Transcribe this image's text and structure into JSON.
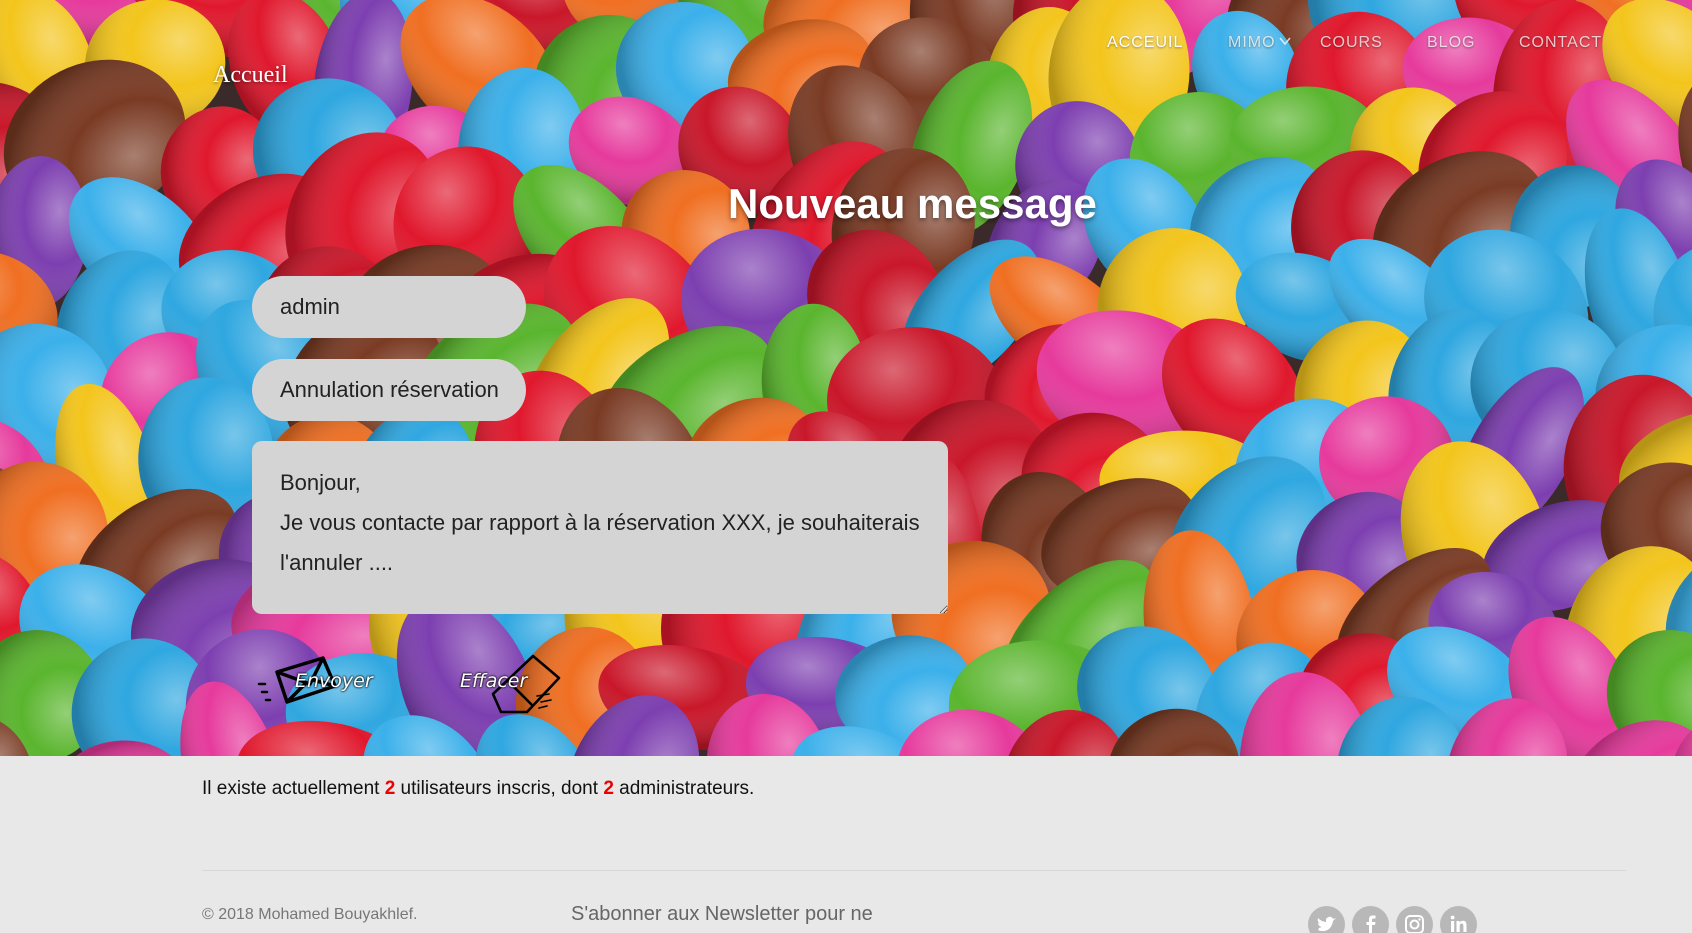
{
  "header": {
    "brand": "Accueil",
    "nav": [
      {
        "label": "ACCEUIL",
        "active": true
      },
      {
        "label": "MIMO",
        "has_dropdown": true
      },
      {
        "label": "COURS"
      },
      {
        "label": "BLOG"
      },
      {
        "label": "CONTACT"
      }
    ]
  },
  "form": {
    "title": "Nouveau message",
    "recipient_value": "admin",
    "subject_value": "Annulation réservation",
    "message_value": "Bonjour,\nJe vous contacte par rapport à la réservation XXX, je souhaiterais l'annuler ....",
    "send_label": "Envoyer",
    "clear_label": "Effacer"
  },
  "stats": {
    "prefix": "Il existe actuellement ",
    "users_count": "2",
    "middle": " utilisateurs inscris, dont ",
    "admins_count": "2",
    "suffix": " administrateurs."
  },
  "footer": {
    "copyright": "© 2018 Mohamed Bouyakhlef.",
    "newsletter": "S'abonner aux Newsletter pour ne",
    "socials": [
      "twitter-icon",
      "facebook-icon",
      "instagram-icon",
      "linkedin-icon"
    ]
  },
  "colors": {
    "accent_count": "#e00000",
    "field_bg": "#d4d4d4",
    "footer_bg": "#e8e8e8"
  }
}
